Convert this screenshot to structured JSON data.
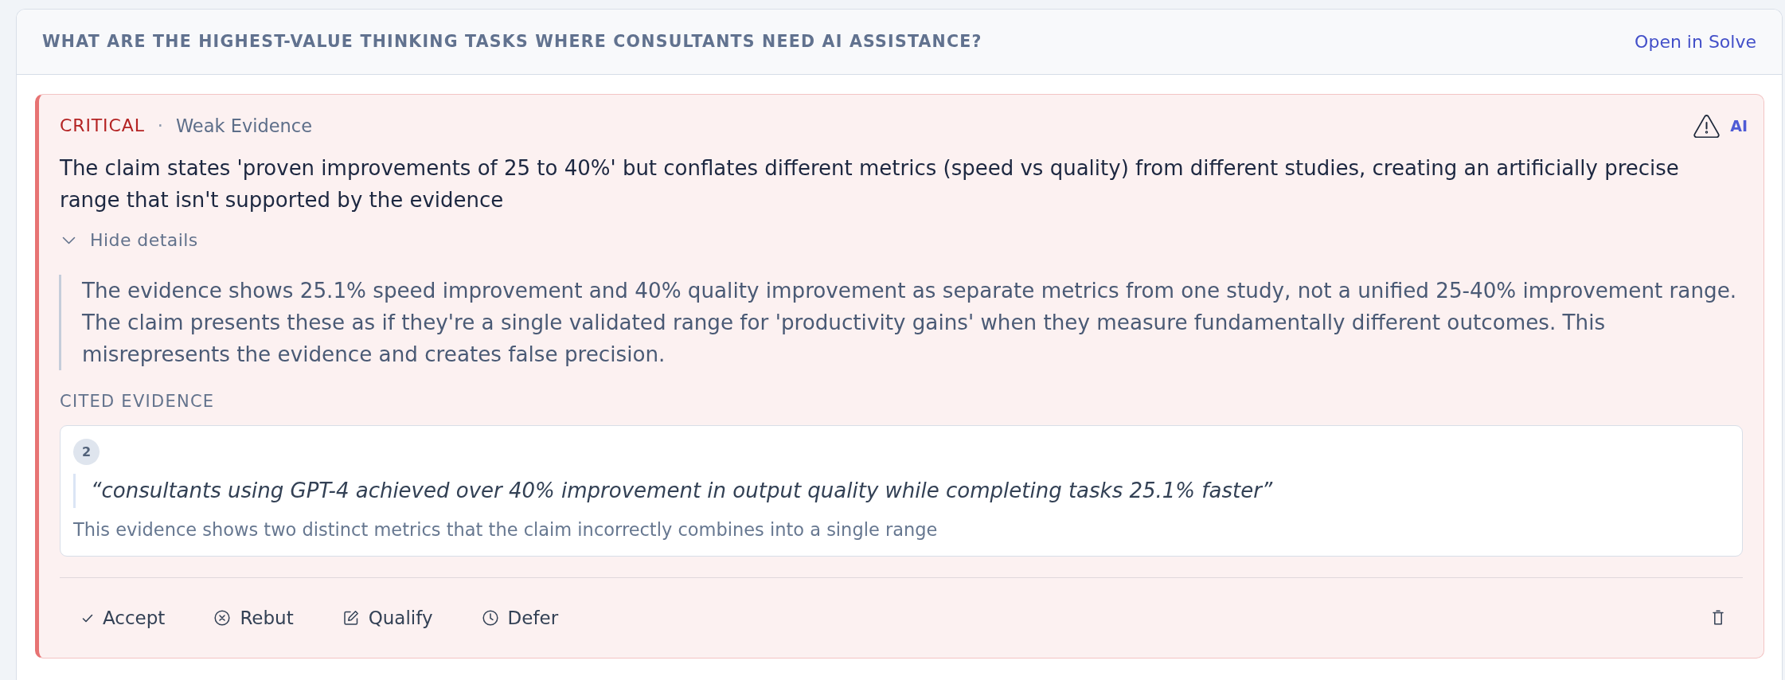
{
  "panel": {
    "title": "WHAT ARE THE HIGHEST-VALUE THINKING TASKS WHERE CONSULTANTS NEED AI ASSISTANCE?",
    "action": "Open in Solve"
  },
  "issues": [
    {
      "kind": "critical",
      "severity": "CRITICAL",
      "separator": "·",
      "category": "Weak Evidence",
      "ai_label": "AI",
      "claim": "The claim states 'proven improvements of 25 to 40%' but conflates different metrics (speed vs quality) from different studies, creating an artificially precise range that isn't supported by the evidence",
      "details_toggle": {
        "label": "Hide details",
        "expanded": true
      },
      "explanation": "The evidence shows 25.1% speed improvement and 40% quality improvement as separate metrics from one study, not a unified 25-40% improvement range. The claim presents these as if they're a single validated range for 'productivity gains' when they measure fundamentally different outcomes. This misrepresents the evidence and creates false precision.",
      "cited_label": "CITED EVIDENCE",
      "citations": [
        {
          "number": "2",
          "quote": "“consultants using GPT-4 achieved over 40% improvement in output quality while completing tasks 25.1% faster”",
          "note": "This evidence shows two distinct metrics that the claim incorrectly combines into a single range"
        }
      ],
      "actions": [
        {
          "kind": "accept",
          "label": "Accept"
        },
        {
          "kind": "rebut",
          "label": "Rebut"
        },
        {
          "kind": "qualify",
          "label": "Qualify"
        },
        {
          "kind": "defer",
          "label": "Defer"
        }
      ]
    }
  ]
}
